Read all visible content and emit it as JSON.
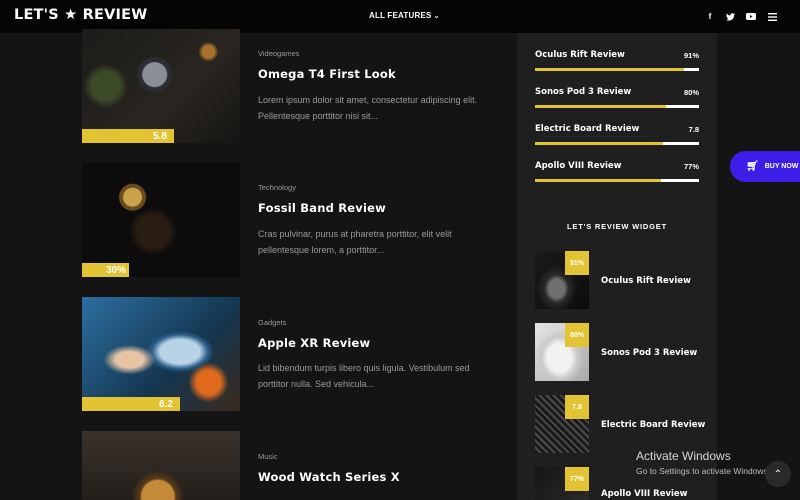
{
  "header": {
    "logo": "LET'S ★ REVIEW",
    "nav_features": "ALL FEATURES",
    "social_icons": [
      "facebook-icon",
      "twitter-icon",
      "youtube-icon",
      "menu-icon"
    ]
  },
  "posts": [
    {
      "category": "Videogames",
      "title": "Omega T4 First Look",
      "excerpt": "Lorem ipsum dolor sit amet, consectetur adipiscing elit. Pellentesque porttitor nisi sit...",
      "score": "5.8",
      "score_fraction": 0.58
    },
    {
      "category": "Technology",
      "title": "Fossil Band Review",
      "excerpt": "Cras pulvinar, purus at pharetra porttitor, elit velit pellentesque lorem, a porttitor...",
      "score": "30%",
      "score_fraction": 0.3
    },
    {
      "category": "Gadgets",
      "title": "Apple XR Review",
      "excerpt": "Lid bibendum turpis libero quis ligula. Vestibulum sed porttitor nulla. Sed vehicula...",
      "score": "6.2",
      "score_fraction": 0.62
    },
    {
      "category": "Music",
      "title": "Wood Watch Series X",
      "excerpt": "",
      "score": "",
      "score_fraction": 0
    }
  ],
  "sidebar": {
    "reviews": [
      {
        "label": "Oculus Rift Review",
        "score": "91%",
        "fraction": 0.91
      },
      {
        "label": "Sonos Pod 3 Review",
        "score": "80%",
        "fraction": 0.8
      },
      {
        "label": "Electric Board Review",
        "score": "7.8",
        "fraction": 0.78
      },
      {
        "label": "Apollo VIII Review",
        "score": "77%",
        "fraction": 0.77
      }
    ],
    "widget_title": "LET'S REVIEW WIDGET",
    "widget_items": [
      {
        "label": "Oculus Rift Review",
        "badge": "91%"
      },
      {
        "label": "Sonos Pod 3 Review",
        "badge": "80%"
      },
      {
        "label": "Electric Board Review",
        "badge": "7.8"
      },
      {
        "label": "Apollo VIII Review",
        "badge": "77%"
      }
    ]
  },
  "buy_now": "BUY NOW",
  "overlay": {
    "title": "Activate Windows",
    "subtitle": "Go to Settings to activate Windows."
  },
  "colors": {
    "accent": "#e2c334",
    "buy_now": "#3d1ee8",
    "background": "#141414",
    "sidebar": "#1f1f1f"
  }
}
